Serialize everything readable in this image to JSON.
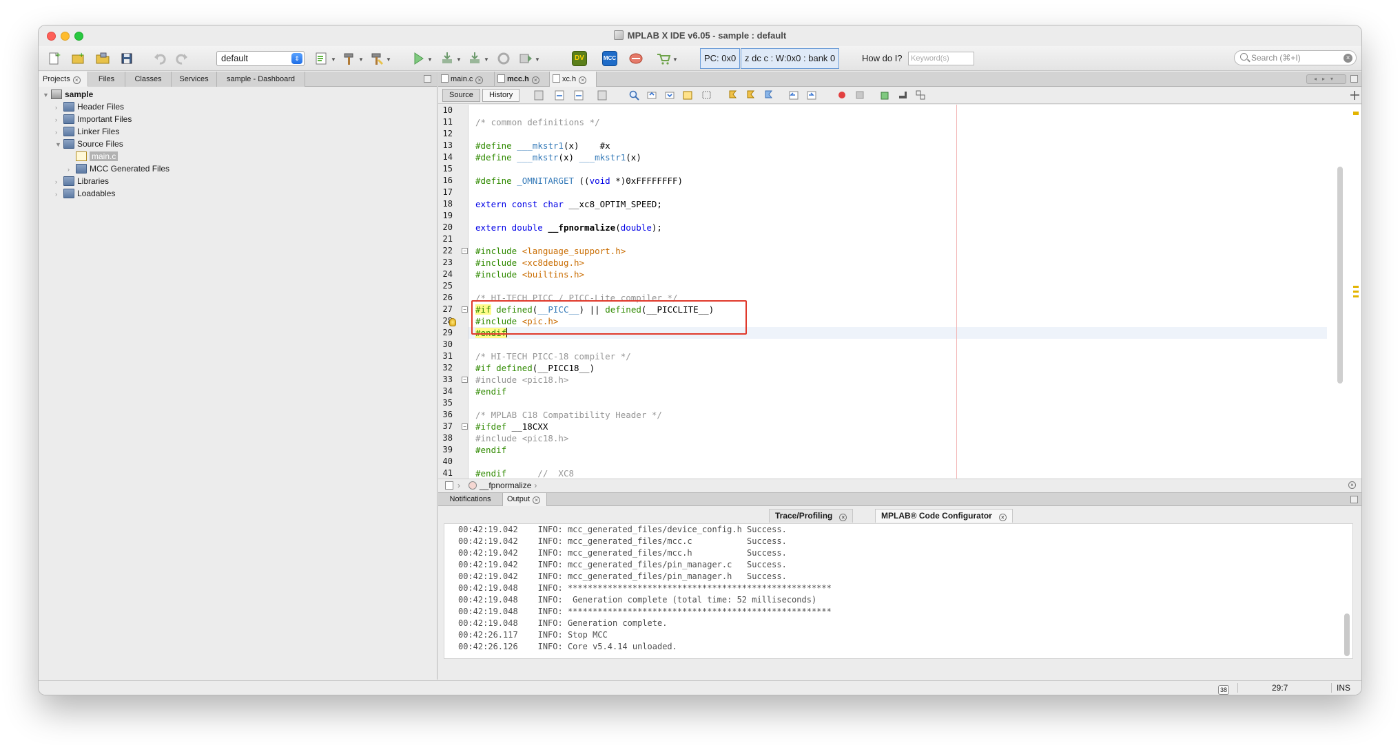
{
  "window": {
    "title": "MPLAB X IDE v6.05 - sample : default"
  },
  "toolbar": {
    "config_select": "default",
    "pc_label": "PC: 0x0",
    "status_label": "z dc c  : W:0x0 : bank 0",
    "howdoi_label": "How do I?",
    "keyword_placeholder": "Keyword(s)",
    "search_placeholder": "Search (⌘+I)",
    "mcc_label": "MCC",
    "dv_label": "DV"
  },
  "left_tabs": [
    "Projects",
    "Files",
    "Classes",
    "Services",
    "sample - Dashboard"
  ],
  "tree": {
    "project": "sample",
    "items": [
      {
        "label": "Header Files"
      },
      {
        "label": "Important Files"
      },
      {
        "label": "Linker Files"
      },
      {
        "label": "Source Files"
      },
      {
        "label": "main.c"
      },
      {
        "label": "MCC Generated Files"
      },
      {
        "label": "Libraries"
      },
      {
        "label": "Loadables"
      }
    ]
  },
  "editor_tabs": [
    "main.c",
    "mcc.h",
    "xc.h"
  ],
  "editor_toolbar": {
    "source": "Source",
    "history": "History"
  },
  "code": {
    "line_numbers": [
      "10",
      "11",
      "12",
      "13",
      "14",
      "15",
      "16",
      "17",
      "18",
      "19",
      "20",
      "21",
      "22",
      "23",
      "24",
      "25",
      "26",
      "27",
      "28",
      "29",
      "30",
      "31",
      "32",
      "33",
      "34",
      "35",
      "36",
      "37",
      "38",
      "39",
      "40",
      "41"
    ],
    "lines": {
      "l11": "/* common definitions */",
      "l13a": "#define",
      "l13b": " ___mkstr1",
      "l13c": "(x)    #x",
      "l14a": "#define",
      "l14b": " ___mkstr",
      "l14c": "(x) ",
      "l14d": "___mkstr1",
      "l14e": "(x)",
      "l16a": "#define",
      "l16b": " _OMNITARGET",
      "l16c": " ((",
      "l16d": "void",
      "l16e": " *)0xFFFFFFFF)",
      "l18a": "extern const char",
      "l18b": " __xc8_OPTIM_SPEED;",
      "l20a": "extern double",
      "l20b": " __fpnormalize",
      "l20c": "(",
      "l20d": "double",
      "l20e": ");",
      "l22a": "#include",
      "l22b": " <language_support.h>",
      "l23a": "#include",
      "l23b": " <xc8debug.h>",
      "l24a": "#include",
      "l24b": " <builtins.h>",
      "l26": "/* HI-TECH PICC / PICC-Lite compiler */",
      "l27a": "#if",
      "l27b": " defined",
      "l27c": "(",
      "l27d": "__PICC__",
      "l27e": ") || ",
      "l27f": "defined",
      "l27g": "(__PICCLITE__)",
      "l28a": "#include",
      "l28b": " <pic.h>",
      "l29a": "#endif",
      "l31": "/* HI-TECH PICC-18 compiler */",
      "l32a": "#if defined",
      "l32b": "(__PICC18__)",
      "l33": "#include <pic18.h>",
      "l34": "#endif",
      "l36": "/* MPLAB C18 Compatibility Header */",
      "l37a": "#ifdef",
      "l37b": " __18CXX",
      "l38": "#include <pic18.h>",
      "l39": "#endif",
      "l41a": "#endif",
      "l41b": "      //  XC8"
    }
  },
  "breadcrumb": {
    "function": "__fpnormalize"
  },
  "output_tabs": [
    "Notifications",
    "Output"
  ],
  "output_subtabs": [
    "Trace/Profiling",
    "MPLAB® Code Configurator"
  ],
  "output_lines": [
    "00:42:19.042    INFO: mcc_generated_files/device_config.h Success.",
    "00:42:19.042    INFO: mcc_generated_files/mcc.c           Success.",
    "00:42:19.042    INFO: mcc_generated_files/mcc.h           Success.",
    "00:42:19.042    INFO: mcc_generated_files/pin_manager.c   Success.",
    "00:42:19.042    INFO: mcc_generated_files/pin_manager.h   Success.",
    "00:42:19.048    INFO: *****************************************************",
    "00:42:19.048    INFO:  Generation complete (total time: 52 milliseconds)",
    "00:42:19.048    INFO: *****************************************************",
    "00:42:19.048    INFO: Generation complete.",
    "00:42:26.117    INFO: Stop MCC",
    "00:42:26.126    INFO: Core v5.4.14 unloaded."
  ],
  "status": {
    "notifications": "38",
    "position": "29:7",
    "mode": "INS"
  },
  "colors": {
    "highlight_box": "#e0392b",
    "keyword": "#0000e6",
    "preprocessor": "#2f8a00",
    "string": "#c96c00",
    "comment": "#969696"
  }
}
